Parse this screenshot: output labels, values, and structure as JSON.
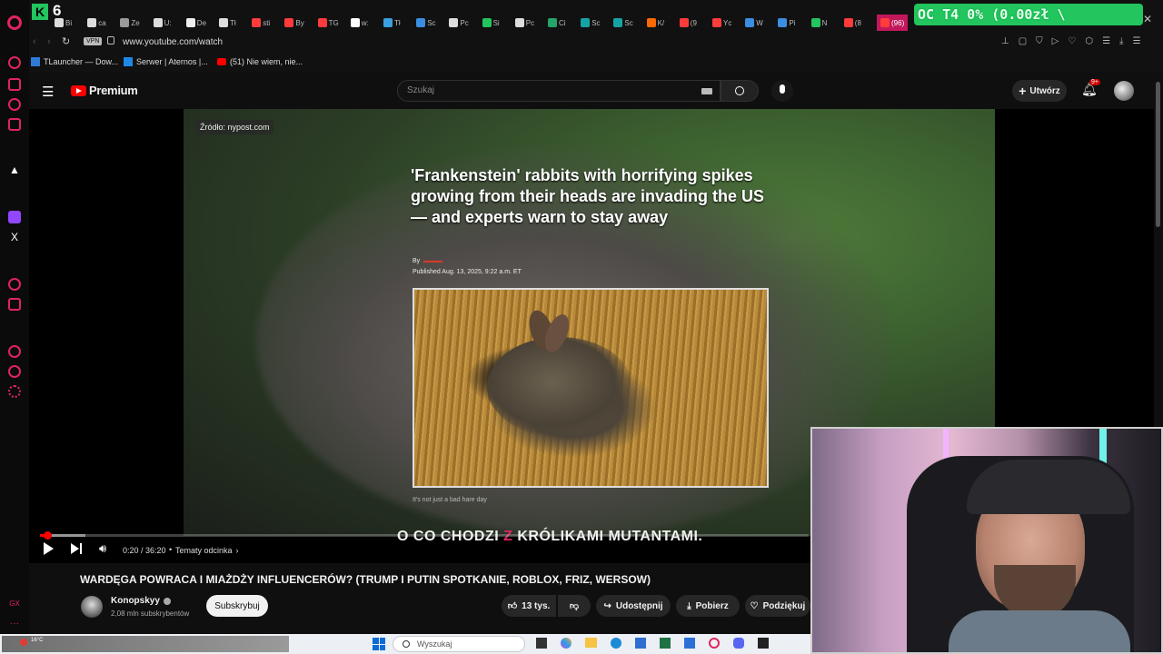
{
  "browser": {
    "badge_count": "6",
    "tabs": [
      "Bi",
      "ca",
      "Ze",
      "U:",
      "De",
      "Tł",
      "sti",
      "By",
      "TG",
      "w:",
      "Tł",
      "Sc",
      "Pc",
      "Si",
      "Pc",
      "Ci",
      "Sc",
      "Sc",
      "K/",
      "(9",
      "Yc",
      "W",
      "Pi",
      "N",
      "(8",
      "(96)"
    ],
    "url": "www.youtube.com/watch",
    "vpn_label": "VPN",
    "overlay_text": "OC T4 0% (0.00zł \\",
    "bookmarks": [
      "TLauncher — Dow...",
      "Serwer | Aternos |...",
      "(51) Nie wiem, nie..."
    ]
  },
  "yt_header": {
    "logo_text": "Premium",
    "search_placeholder": "Szukaj",
    "create_label": "Utwórz",
    "notif_count": "9+"
  },
  "video": {
    "source_label": "Źródło: nypost.com",
    "article_headline": "'Frankenstein' rabbits with horrifying spikes growing from their heads are invading the US — and experts warn to stay away",
    "article_byline": "By",
    "article_published": "Published Aug. 13, 2025, 9:22 a.m. ET",
    "article_caption": "It's not just a bad hare day",
    "subtitle_parts": [
      "O CO CHODZI ",
      "Z",
      " KRÓLIKAMI MUTANTAMI."
    ],
    "time": "0:20 / 36:20",
    "chapters_label": "Tematy odcinka",
    "progress": 0.0092
  },
  "details": {
    "title": "WARDĘGA POWRACA I MIAŻDŻY INFLUENCERÓW? (TRUMP I PUTIN SPOTKANIE, ROBLOX, FRIZ, WERSOW)",
    "channel_name": "Konopskyy",
    "subscribers": "2,08 mln subskrybentów",
    "subscribe_label": "Subskrybuj",
    "likes": "13 tys.",
    "share_label": "Udostępnij",
    "download_label": "Pobierz",
    "thanks_label": "Podziękuj"
  },
  "taskbar": {
    "search_placeholder": "Wyszukaj",
    "weather": "16°C"
  },
  "colors": {
    "yt_red": "#ff0000",
    "overlay_green": "#22c55e",
    "opera_red": "#e0245e"
  }
}
